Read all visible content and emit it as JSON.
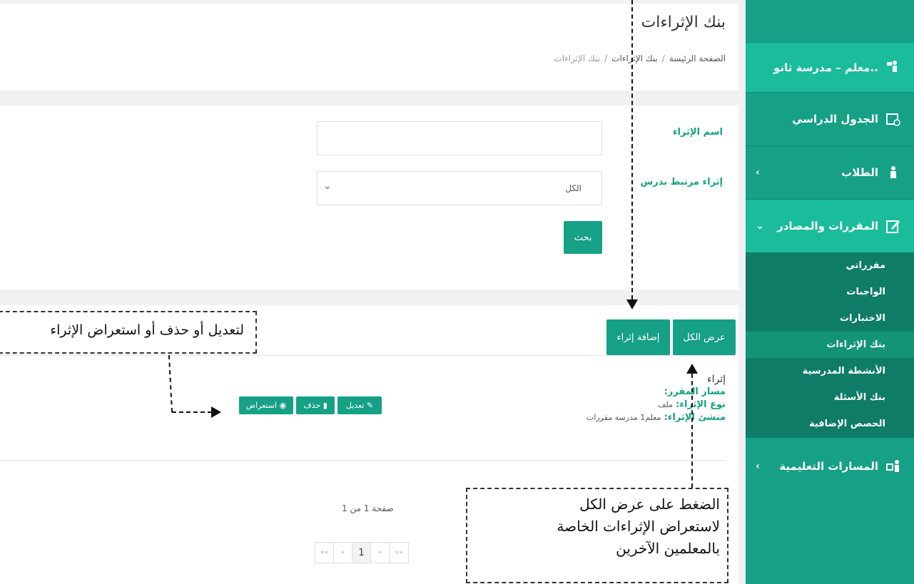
{
  "sidebar": {
    "items": [
      {
        "label": "معلم – مدرسة ثانو..",
        "icon": "teacher-icon"
      },
      {
        "label": "الجدول الدراسي",
        "icon": "calendar-icon"
      },
      {
        "label": "الطلاب",
        "icon": "students-icon"
      },
      {
        "label": "المقررات والمصادر",
        "icon": "edit-icon"
      },
      {
        "label": "المسارات التعليمية",
        "icon": "paths-icon"
      }
    ],
    "submenu": [
      "مقرراتي",
      "الواجبات",
      "الاختبارات",
      "بنك الإثراءات",
      "الأنشطة المدرسية",
      "بنك الأسئلة",
      "الحصص الإضافية"
    ]
  },
  "header": {
    "title": "بنك الإثراءات",
    "breadcrumb": [
      "الصفحة الرئيسة",
      "بنك الإثراءات",
      "بنك الإثراءات"
    ]
  },
  "form": {
    "name_label": "اسم الإثراء",
    "lesson_label": "إثراء مرتبط بدرس",
    "lesson_value": "الكل",
    "search_button": "بحث"
  },
  "list": {
    "show_all_button": "عرض الكل",
    "add_button": "إضافة إثراء",
    "item": {
      "title": "إثراء",
      "course_path_label": "مسار المقرر:",
      "type_label": "نوع الإثراء:",
      "type_value": "ملف",
      "creator_label": "منشئ الإثراء:",
      "creator_value": "معلم1 مدرسة مقررات"
    },
    "edit_button": "تعديل",
    "delete_button": "حذف",
    "view_button": "استعراض",
    "page_info": "صفحة 1 من 1",
    "pager": [
      "««",
      "«",
      "1",
      "»",
      "»»"
    ]
  },
  "annotations": {
    "edit_note": "لتعديل أو حذف أو استعراض الإثراء",
    "show_all_note": [
      "الضغط على عرض الكل",
      "لاستعراض الإثراءات الخاصة",
      "بالمعلمين الآخرين"
    ]
  },
  "colors": {
    "accent": "#16a085",
    "sidebar_dark": "#0e7c66"
  }
}
